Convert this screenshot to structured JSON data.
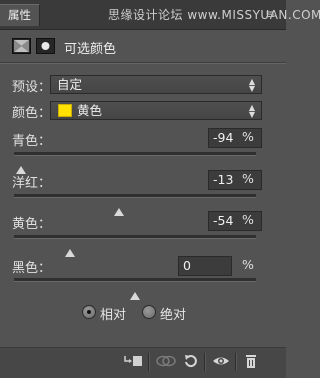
{
  "panel": {
    "tab_label": "属性",
    "watermark": "思缘设计论坛 www.MISSYUAN.COM",
    "menu_icon": "≡",
    "close_icon": "✕",
    "title": "可选颜色"
  },
  "preset": {
    "label": "预设：",
    "value": "自定"
  },
  "color": {
    "label": "颜色：",
    "value": "黄色",
    "swatch_hex": "#ffe200"
  },
  "sliders": [
    {
      "label": "青色：",
      "value": "-94",
      "unit": "%",
      "fraction": 0.03
    },
    {
      "label": "洋红：",
      "value": "-13",
      "unit": "%",
      "fraction": 0.435
    },
    {
      "label": "黄色：",
      "value": "-54",
      "unit": "%",
      "fraction": 0.23
    },
    {
      "label": "黑色：",
      "value": "0",
      "unit": "%",
      "fraction": 0.5
    }
  ],
  "method": {
    "options": [
      "相对",
      "绝对"
    ],
    "selected": "相对"
  },
  "footer_icons": [
    "clip-to-layer-icon",
    "visibility-toggle-icon",
    "reset-icon",
    "eye-icon",
    "trash-icon"
  ]
}
